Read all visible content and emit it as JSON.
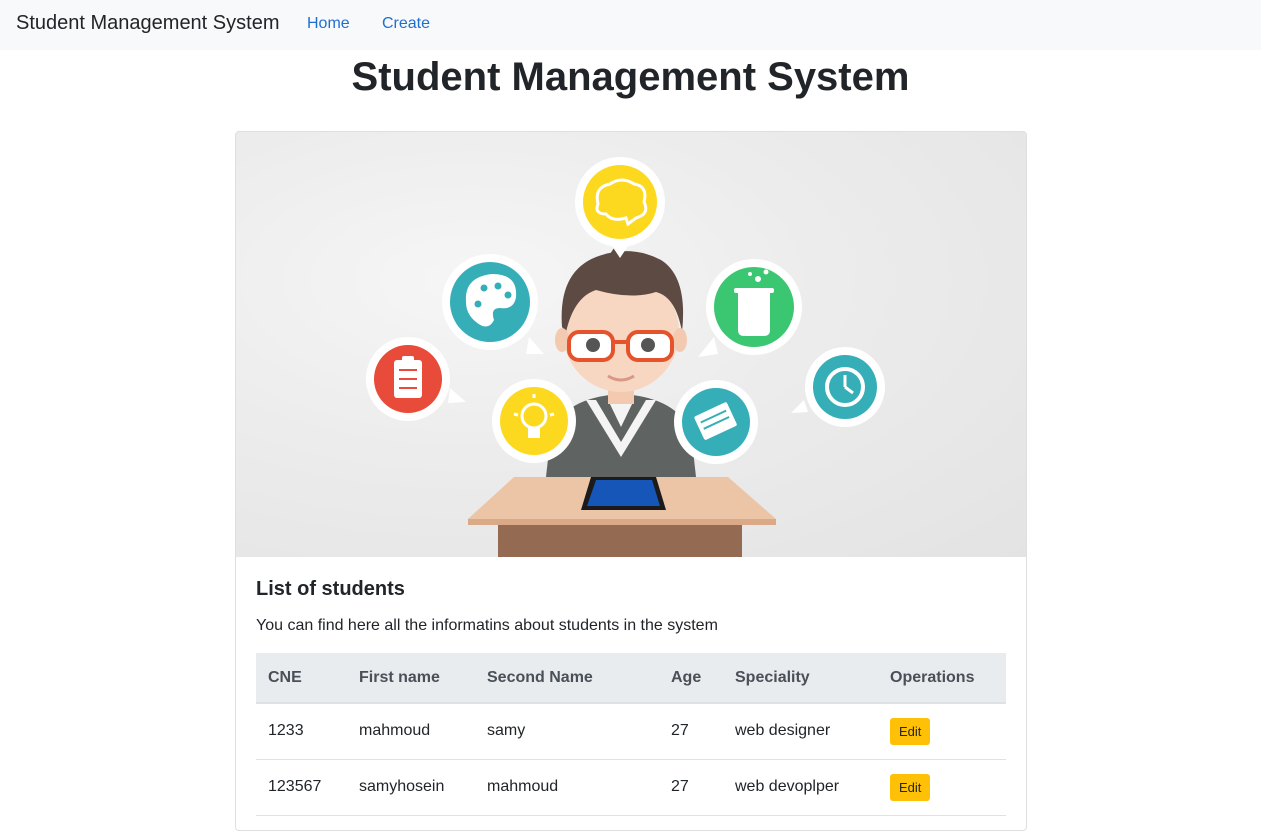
{
  "navbar": {
    "brand": "Student Management System",
    "links": [
      "Home",
      "Create"
    ]
  },
  "page": {
    "title": "Student Management System"
  },
  "card": {
    "title": "List of students",
    "text": "You can find here all the informatins about students in the system"
  },
  "table": {
    "headers": [
      "CNE",
      "First name",
      "Second Name",
      "Age",
      "Speciality",
      "Operations"
    ],
    "rows": [
      {
        "cne": "1233",
        "first": "mahmoud",
        "second": "samy",
        "age": "27",
        "speciality": "web designer",
        "action": "Edit"
      },
      {
        "cne": "123567",
        "first": "samyhosein",
        "second": "mahmoud",
        "age": "27",
        "speciality": "web devoplper",
        "action": "Edit"
      }
    ]
  },
  "colors": {
    "navbar_bg": "#f8f9fa",
    "link": "#1f6fd1",
    "table_head_bg": "#e9ecef",
    "edit_button": "#ffc107"
  },
  "icons": [
    "palette-icon",
    "brain-icon",
    "beaker-icon",
    "checklist-icon",
    "lightbulb-icon",
    "books-icon",
    "clock-icon"
  ]
}
